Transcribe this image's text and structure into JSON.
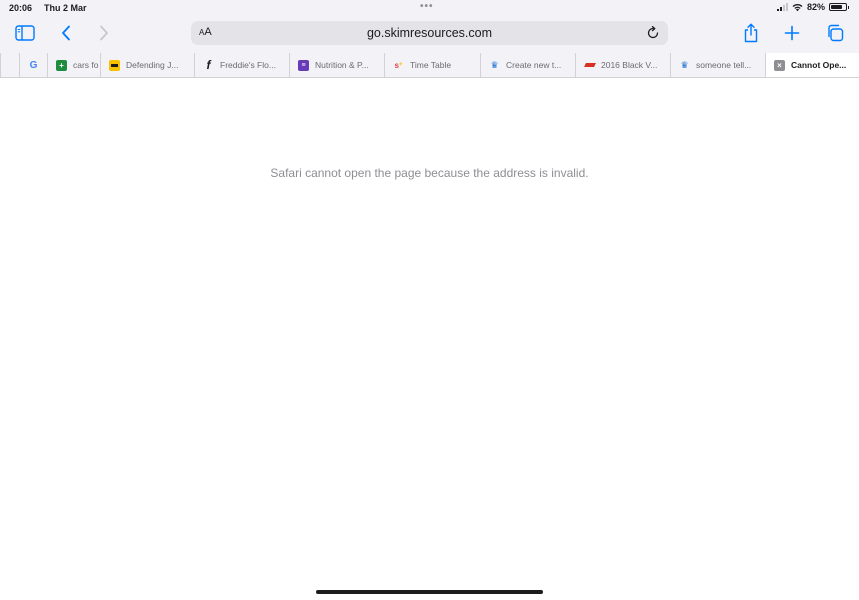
{
  "status_bar": {
    "time": "20:06",
    "date": "Thu 2 Mar",
    "battery": "82%",
    "battery_level": 0.82
  },
  "toolbar": {
    "aa_label_small": "A",
    "aa_label_large": "A",
    "url": "go.skimresources.com"
  },
  "tabs": [
    {
      "title": "",
      "icon": "google-icon"
    },
    {
      "title": "cars fo",
      "icon": "sheets-icon"
    },
    {
      "title": "Defending J...",
      "icon": "site-icon"
    },
    {
      "title": "Freddie's Flo...",
      "icon": "freddies-icon"
    },
    {
      "title": "Nutrition & P...",
      "icon": "forms-icon"
    },
    {
      "title": "Time Table",
      "icon": "timetable-icon"
    },
    {
      "title": "Create new t...",
      "icon": "crown-icon"
    },
    {
      "title": "2016 Black V...",
      "icon": "site-icon"
    },
    {
      "title": "someone tell...",
      "icon": "crown-icon"
    },
    {
      "title": "Cannot Ope...",
      "icon": "close-tab-icon",
      "active": true
    }
  ],
  "content": {
    "error_message": "Safari cannot open the page because the address is invalid."
  },
  "colors": {
    "accent": "#007aff",
    "chrome_bg": "#f2f2f7",
    "message": "#8e8e93"
  }
}
